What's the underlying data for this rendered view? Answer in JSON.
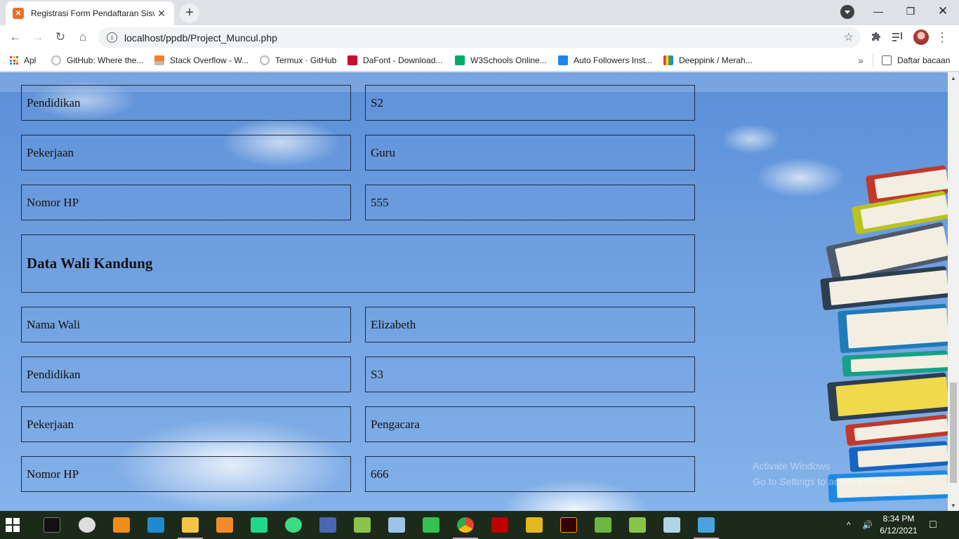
{
  "browser": {
    "tab_title": "Registrasi Form Pendaftaran Siswa",
    "tab_favicon": "xampp-icon",
    "url": "localhost/ppdb/Project_Muncul.php"
  },
  "bookmarks": [
    {
      "label": "Apl",
      "icon": "apps-grid-icon"
    },
    {
      "label": "GitHub: Where the...",
      "icon": "github-icon"
    },
    {
      "label": "Stack Overflow - W...",
      "icon": "stackoverflow-icon"
    },
    {
      "label": "Termux · GitHub",
      "icon": "github-icon"
    },
    {
      "label": "DaFont - Download...",
      "icon": "dafont-icon"
    },
    {
      "label": "W3Schools Online...",
      "icon": "w3schools-icon"
    },
    {
      "label": "Auto Followers Inst...",
      "icon": "cube-icon"
    },
    {
      "label": "Deeppink / Merah...",
      "icon": "color-bars-icon"
    }
  ],
  "reading_list": "Daftar bacaan",
  "form": {
    "ibu": [
      {
        "label": "Pendidikan",
        "value": "S2"
      },
      {
        "label": "Pekerjaan",
        "value": "Guru"
      },
      {
        "label": "Nomor HP",
        "value": "555"
      }
    ],
    "wali_section_title": "Data Wali Kandung",
    "wali": [
      {
        "label": "Nama Wali",
        "value": "Elizabeth"
      },
      {
        "label": "Pendidikan",
        "value": "S3"
      },
      {
        "label": "Pekerjaan",
        "value": "Pengacara"
      },
      {
        "label": "Nomor HP",
        "value": "666"
      }
    ]
  },
  "watermark": {
    "line1": "Activate Windows",
    "line2": "Go to Settings to activate Windows."
  },
  "taskbar": {
    "time": "8:34 PM",
    "date": "6/12/2021"
  },
  "colors": {
    "tab_bg": "#ffffff",
    "chrome_bg": "#dee1e6",
    "cell_border": "#1f2a44",
    "taskbar_bg": "#1c2a1a"
  }
}
